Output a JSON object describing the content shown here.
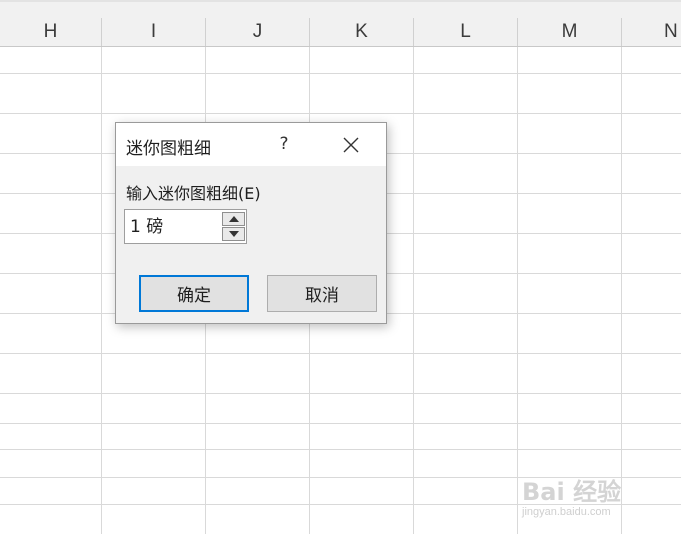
{
  "sheet": {
    "columns": [
      "H",
      "I",
      "J",
      "K",
      "L",
      "M",
      "N"
    ]
  },
  "dialog": {
    "title": "迷你图粗细",
    "help_glyph": "?",
    "field_label": "输入迷你图粗细(E)",
    "weight_value": "1 磅",
    "ok_label": "确定",
    "cancel_label": "取消",
    "accent_color": "#0078d7"
  },
  "watermark": {
    "brand": "Bai 经验",
    "url": "jingyan.baidu.com"
  }
}
